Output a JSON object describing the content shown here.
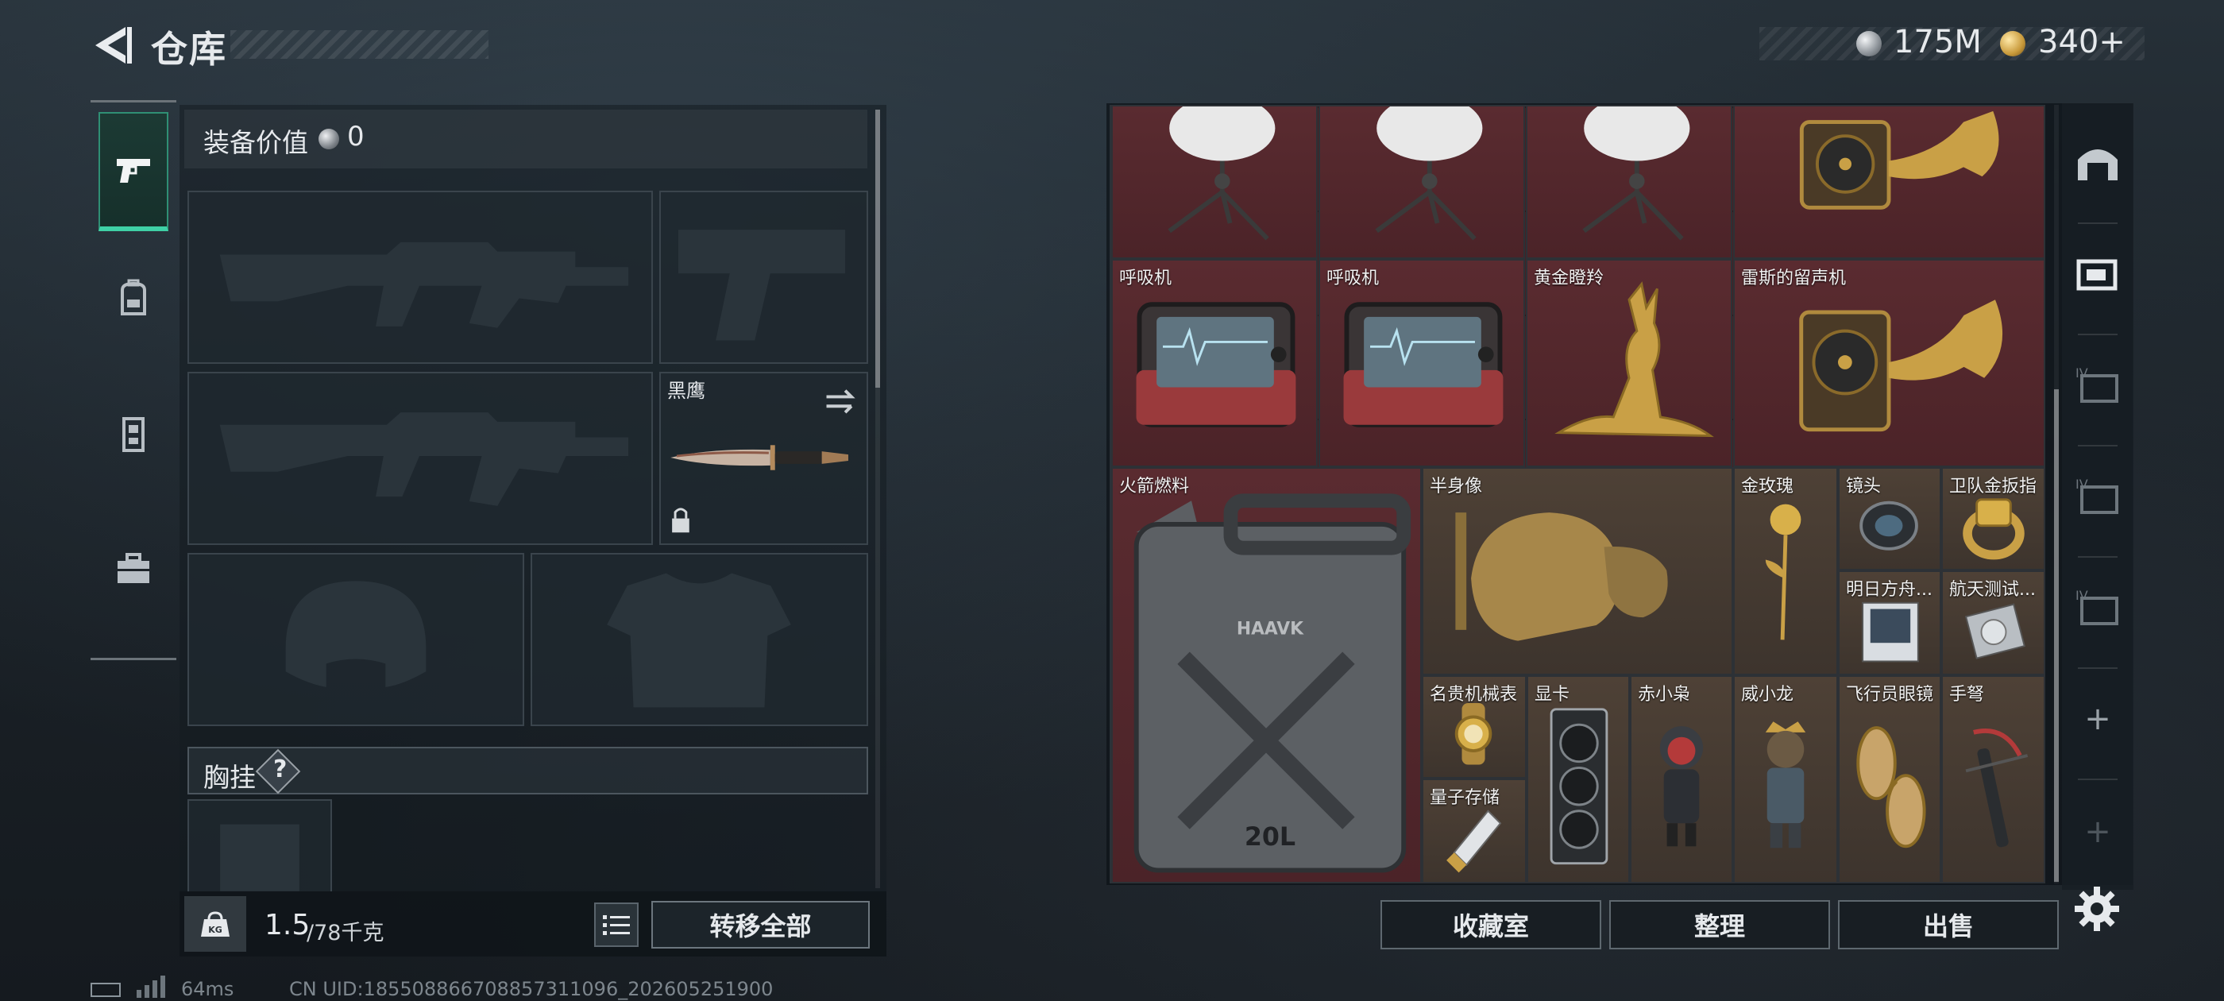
{
  "header": {
    "title": "仓库",
    "currencies": [
      {
        "icon": "silver-coin-icon",
        "value": "175M"
      },
      {
        "icon": "gold-coin-icon",
        "value": "340+"
      }
    ]
  },
  "left_tabs": [
    {
      "icon": "pistol-icon",
      "active": true
    },
    {
      "icon": "backpack-icon",
      "active": false
    },
    {
      "icon": "vest-icon",
      "active": false
    },
    {
      "icon": "case-icon",
      "active": false
    }
  ],
  "loadout": {
    "equip_value_label": "装备价值",
    "equip_value": "0",
    "knife_name": "黑鹰",
    "chest_rig_label": "胸挂",
    "chest_help": "?"
  },
  "bottom_bar": {
    "weight_current": "1.5",
    "weight_rest": "/78千克",
    "weight_icon_text": "KG",
    "transfer_all": "转移全部"
  },
  "stash": {
    "items": [
      {
        "name": "",
        "icon": "satellite-dish-icon"
      },
      {
        "name": "",
        "icon": "satellite-dish-icon"
      },
      {
        "name": "",
        "icon": "satellite-dish-icon"
      },
      {
        "name": "",
        "icon": "gramophone-icon"
      },
      {
        "name": "呼吸机",
        "icon": "ventilator-icon"
      },
      {
        "name": "呼吸机",
        "icon": "ventilator-icon"
      },
      {
        "name": "黄金瞪羚",
        "icon": "golden-gazelle-icon"
      },
      {
        "name": "雷斯的留声机",
        "icon": "gramophone-icon"
      },
      {
        "name": "火箭燃料",
        "icon": "jerrycan-icon",
        "can_text": "20L",
        "brand": "HAAVK"
      },
      {
        "name": "半身像",
        "icon": "bust-statue-icon"
      },
      {
        "name": "金玫瑰",
        "icon": "gold-rose-icon"
      },
      {
        "name": "镜头",
        "icon": "camera-lens-icon"
      },
      {
        "name": "卫队金扳指",
        "icon": "gold-ring-icon"
      },
      {
        "name": "明日方舟...",
        "icon": "album-icon"
      },
      {
        "name": "航天测试...",
        "icon": "hard-drive-icon"
      },
      {
        "name": "名贵机械表",
        "icon": "gold-watch-icon"
      },
      {
        "name": "量子存储",
        "icon": "usb-drive-icon"
      },
      {
        "name": "显卡",
        "icon": "graphics-card-icon"
      },
      {
        "name": "赤小枭",
        "icon": "red-figure-icon"
      },
      {
        "name": "威小龙",
        "icon": "soldier-figure-icon"
      },
      {
        "name": "飞行员眼镜",
        "icon": "aviator-glasses-icon"
      },
      {
        "name": "手弩",
        "icon": "hand-crossbow-icon"
      }
    ],
    "right_tabs": [
      {
        "icon": "stash-home-icon"
      },
      {
        "icon": "stash-page-icon"
      },
      {
        "icon": "stash-page-iv-icon",
        "text": "IV"
      },
      {
        "icon": "stash-page-iv-icon",
        "text": "IV"
      },
      {
        "icon": "stash-page-iv-icon",
        "text": "IV"
      },
      {
        "icon": "plus-icon",
        "text": "+"
      },
      {
        "icon": "plus-icon",
        "text": "+"
      }
    ],
    "buttons": {
      "collection": "收藏室",
      "organize": "整理",
      "sell": "出售"
    }
  },
  "footer": {
    "ping": "64ms",
    "uid": "CN UID:185508866708857311096_202605251900"
  },
  "colors": {
    "accent_green": "#3fd0a6",
    "stash_red": "#4b2328",
    "gold": "#c9a046"
  }
}
